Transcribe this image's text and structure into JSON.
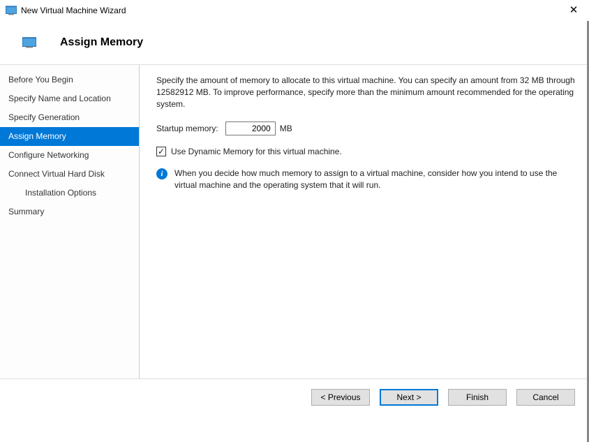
{
  "window": {
    "title": "New Virtual Machine Wizard",
    "close_glyph": "✕"
  },
  "header": {
    "title": "Assign Memory"
  },
  "sidebar": {
    "items": [
      {
        "label": "Before You Begin",
        "indent": false
      },
      {
        "label": "Specify Name and Location",
        "indent": false
      },
      {
        "label": "Specify Generation",
        "indent": false
      },
      {
        "label": "Assign Memory",
        "indent": false
      },
      {
        "label": "Configure Networking",
        "indent": false
      },
      {
        "label": "Connect Virtual Hard Disk",
        "indent": false
      },
      {
        "label": "Installation Options",
        "indent": true
      },
      {
        "label": "Summary",
        "indent": false
      }
    ],
    "active_index": 3
  },
  "main": {
    "description": "Specify the amount of memory to allocate to this virtual machine. You can specify an amount from 32 MB through 12582912 MB. To improve performance, specify more than the minimum amount recommended for the operating system.",
    "startup_label": "Startup memory:",
    "startup_value": "2000",
    "startup_unit": "MB",
    "dynamic_checkbox_label": "Use Dynamic Memory for this virtual machine.",
    "dynamic_checked": true,
    "info_glyph": "i",
    "info_text": "When you decide how much memory to assign to a virtual machine, consider how you intend to use the virtual machine and the operating system that it will run."
  },
  "footer": {
    "previous": "< Previous",
    "next": "Next >",
    "finish": "Finish",
    "cancel": "Cancel"
  },
  "colors": {
    "accent": "#0078d7"
  }
}
